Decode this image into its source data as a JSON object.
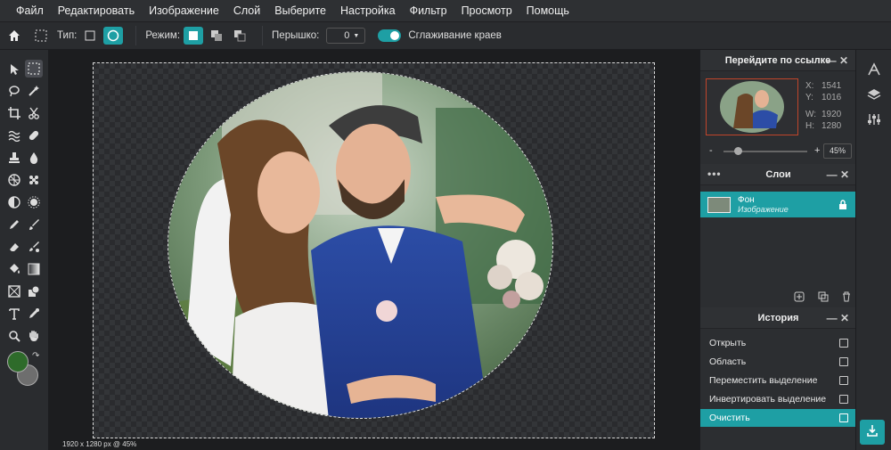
{
  "menu": [
    "Файл",
    "Редактировать",
    "Изображение",
    "Слой",
    "Выберите",
    "Настройка",
    "Фильтр",
    "Просмотр",
    "Помощь"
  ],
  "options": {
    "type_label": "Тип:",
    "mode_label": "Режим:",
    "feather_label": "Перышко:",
    "feather_value": "0",
    "antialias_label": "Сглаживание краев"
  },
  "navigator": {
    "title": "Перейдите по ссылке",
    "x_label": "X:",
    "x_value": "1541",
    "y_label": "Y:",
    "y_value": "1016",
    "w_label": "W:",
    "w_value": "1920",
    "h_label": "H:",
    "h_value": "1280",
    "zoom_minus": "-",
    "zoom_plus": "+",
    "zoom_value": "45%"
  },
  "layers": {
    "title": "Слои",
    "items": [
      {
        "name": "Фон",
        "sub": "Изображение"
      }
    ]
  },
  "history": {
    "title": "История",
    "items": [
      "Открыть",
      "Область",
      "Переместить выделение",
      "Инвертировать выделение",
      "Очистить"
    ]
  },
  "status": "1920 x 1280 px @ 45%",
  "colors": {
    "accent": "#1e9fa4",
    "foreground": "#2e6b2a",
    "background": "#6e6e6e"
  }
}
